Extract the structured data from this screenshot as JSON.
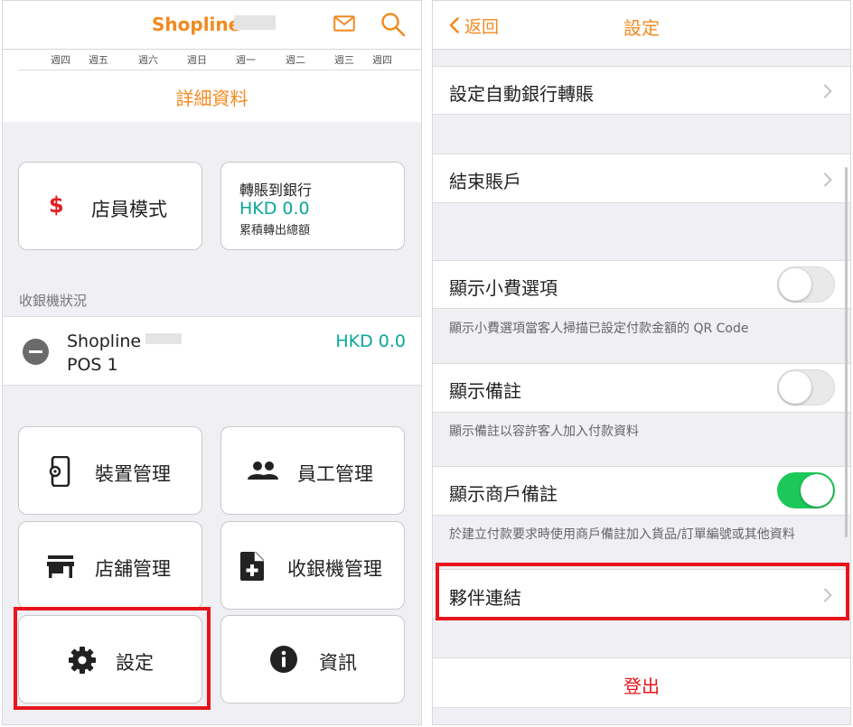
{
  "left": {
    "header": {
      "brand": "Shopline"
    },
    "calendar": {
      "weekdays": [
        "週四",
        "週五",
        "週六",
        "週日",
        "週一",
        "週二",
        "週三",
        "週四"
      ]
    },
    "detail_link": "詳細資料",
    "staff_mode_label": "店員模式",
    "staff_mode_symbol": "$",
    "transfer": {
      "title": "轉賬到銀行",
      "amount": "HKD 0.0",
      "subtitle": "累積轉出總額"
    },
    "section_title": "收銀機狀況",
    "pos": {
      "name": "Shopline",
      "id": "POS 1",
      "amount": "HKD 0.0"
    },
    "menu": {
      "device": "裝置管理",
      "staff": "員工管理",
      "store": "店舖管理",
      "register": "收銀機管理",
      "settings": "設定",
      "info": "資訊"
    },
    "icons": [
      "mail-icon",
      "search-icon",
      "dollar-icon",
      "phone-gear-icon",
      "people-icon",
      "store-icon",
      "add-file-icon",
      "gear-icon",
      "info-icon"
    ]
  },
  "right": {
    "header": {
      "back": "返回",
      "title": "設定"
    },
    "rows": {
      "auto_transfer": "設定自動銀行轉賬",
      "close_account": "結束賬戶",
      "show_tip": "顯示小費選項",
      "show_tip_hint": "顯示小費選項當客人掃描已設定付款金額的 QR Code",
      "show_note": "顯示備註",
      "show_note_hint": "顯示備註以容許客人加入付款資料",
      "show_merchant_note": "顯示商戶備註",
      "show_merchant_note_hint": "於建立付款要求時使用商戶備註加入貨品/訂單編號或其他資料",
      "partner_link": "夥伴連結"
    },
    "toggles": {
      "show_tip": false,
      "show_note": false,
      "show_merchant_note": true
    },
    "logout": "登出"
  },
  "colors": {
    "accent": "#f28a1f",
    "teal": "#0aa79a",
    "highlight": "#e8141c",
    "toggle_on": "#1dc85a",
    "danger": "#e8141c"
  }
}
